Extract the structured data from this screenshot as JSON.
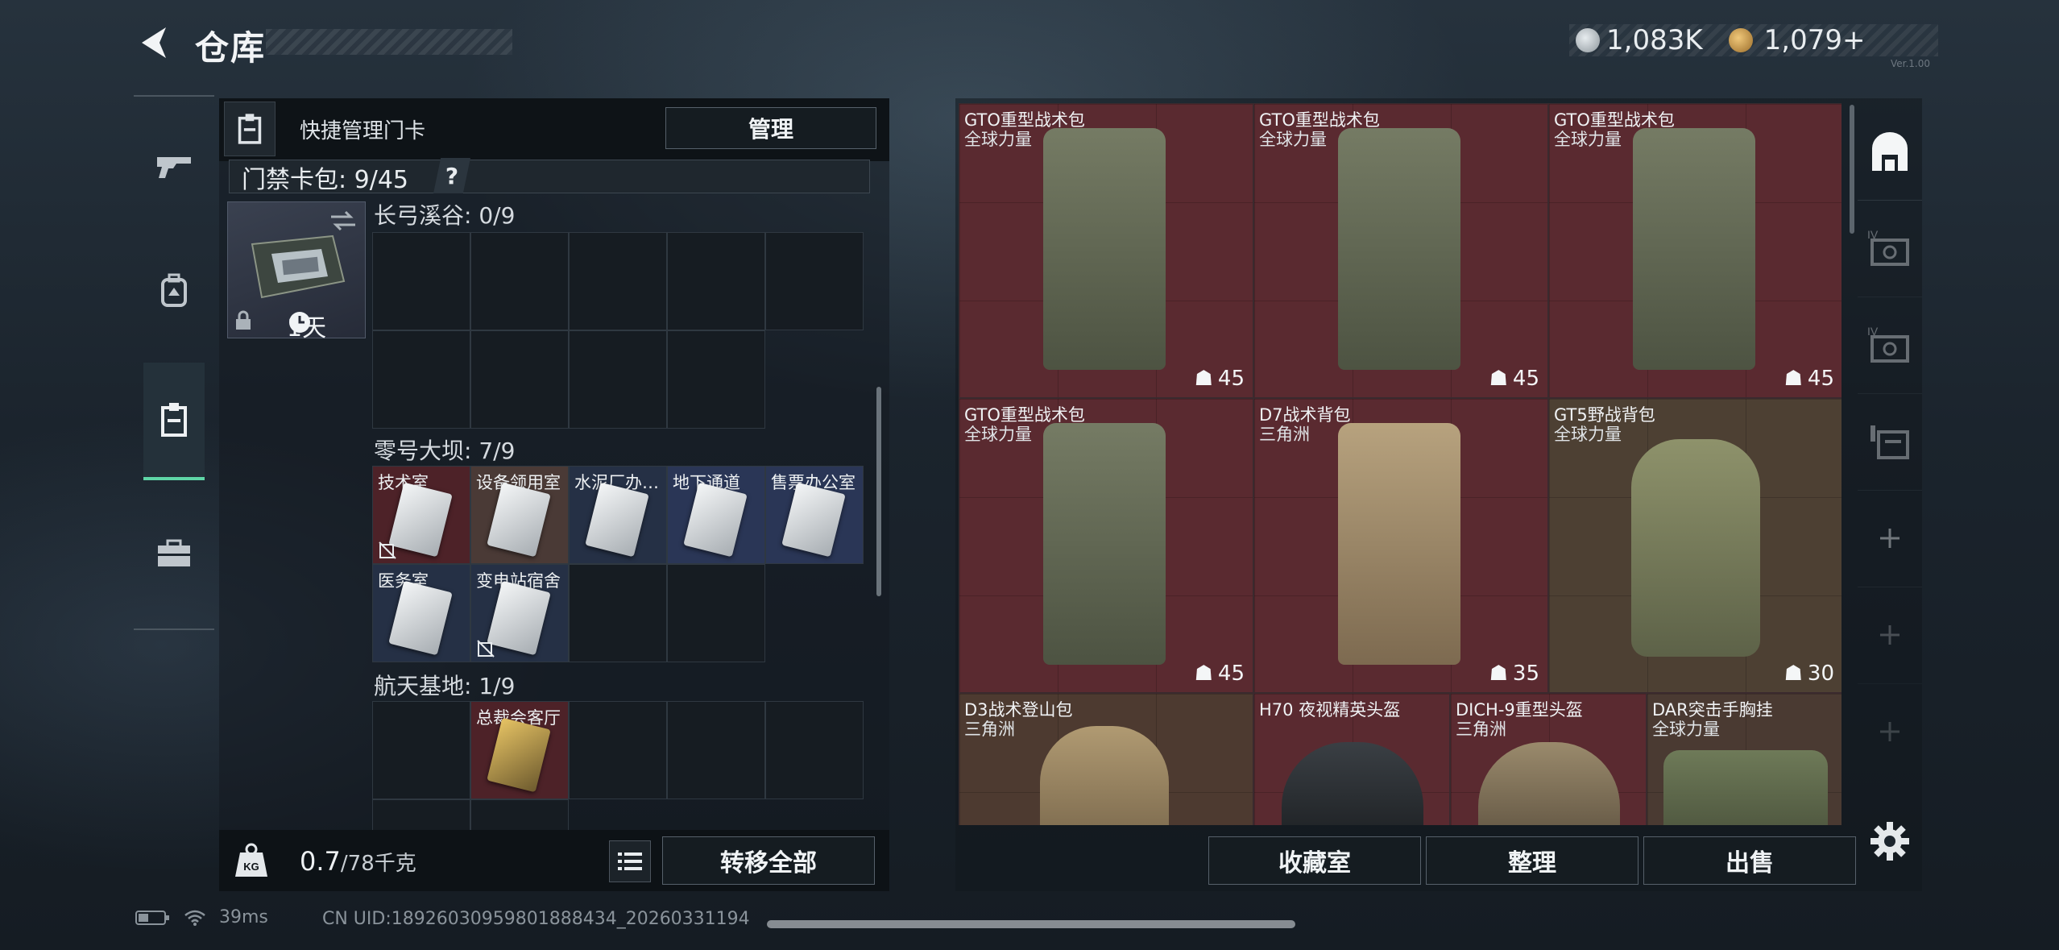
{
  "header": {
    "title": "仓库"
  },
  "currency": {
    "silver": "1,083K",
    "gold": "1,079+",
    "version_hint": "Ver.1.00"
  },
  "left_panel": {
    "quick_manage_label": "快捷管理门卡",
    "manage_button": "管理",
    "card_pack_label": "门禁卡包: 9/45",
    "help_mark": "?",
    "card_tile_days": "1天",
    "zones": [
      {
        "title": "长弓溪谷: 0/9",
        "cells": []
      },
      {
        "title": "零号大坝: 7/9",
        "cells": [
          "技术室",
          "设备领用室",
          "水泥厂办…",
          "地下通道",
          "售票办公室",
          "医务室",
          "变电站宿舍"
        ]
      },
      {
        "title": "航天基地: 1/9",
        "cells": [
          "总裁会客厅"
        ]
      }
    ],
    "weight_value": "0.7",
    "weight_unit": "/78千克",
    "transfer_button": "转移全部"
  },
  "items": [
    {
      "name": "GTO重型战术包",
      "source": "全球力量",
      "count": "45",
      "color": "#5a2a30",
      "art": "green-pack"
    },
    {
      "name": "GTO重型战术包",
      "source": "全球力量",
      "count": "45",
      "color": "#5a2a30",
      "art": "green-pack"
    },
    {
      "name": "GTO重型战术包",
      "source": "全球力量",
      "count": "45",
      "color": "#5a2a30",
      "art": "green-pack"
    },
    {
      "name": "GTO重型战术包",
      "source": "全球力量",
      "count": "45",
      "color": "#5a2a30",
      "art": "green-pack"
    },
    {
      "name": "D7战术背包",
      "source": "三角洲",
      "count": "35",
      "color": "#5a2a30",
      "art": "tan-pack"
    },
    {
      "name": "GT5野战背包",
      "source": "全球力量",
      "count": "30",
      "color": "#4d4033",
      "art": "camo-pack"
    },
    {
      "name": "D3战术登山包",
      "source": "三角洲",
      "count": "",
      "color": "#4d3a30",
      "art": "tan-small"
    },
    {
      "name": "H70 夜视精英头盔",
      "source": "",
      "count": "",
      "color": "#5a2a30",
      "art": "helmet-nv"
    },
    {
      "name": "DICH-9重型头盔",
      "source": "三角洲",
      "count": "",
      "color": "#5a2a30",
      "art": "helmet-camo"
    },
    {
      "name": "DAR突击手胸挂",
      "source": "全球力量",
      "count": "",
      "color": "#4a3a32",
      "art": "vest"
    }
  ],
  "right_footer": {
    "collection_button": "收藏室",
    "organize_button": "整理",
    "sell_button": "出售"
  },
  "status_bar": {
    "ping": "39ms",
    "uid": "CN UID:189260309598018884​34_20260331194"
  }
}
